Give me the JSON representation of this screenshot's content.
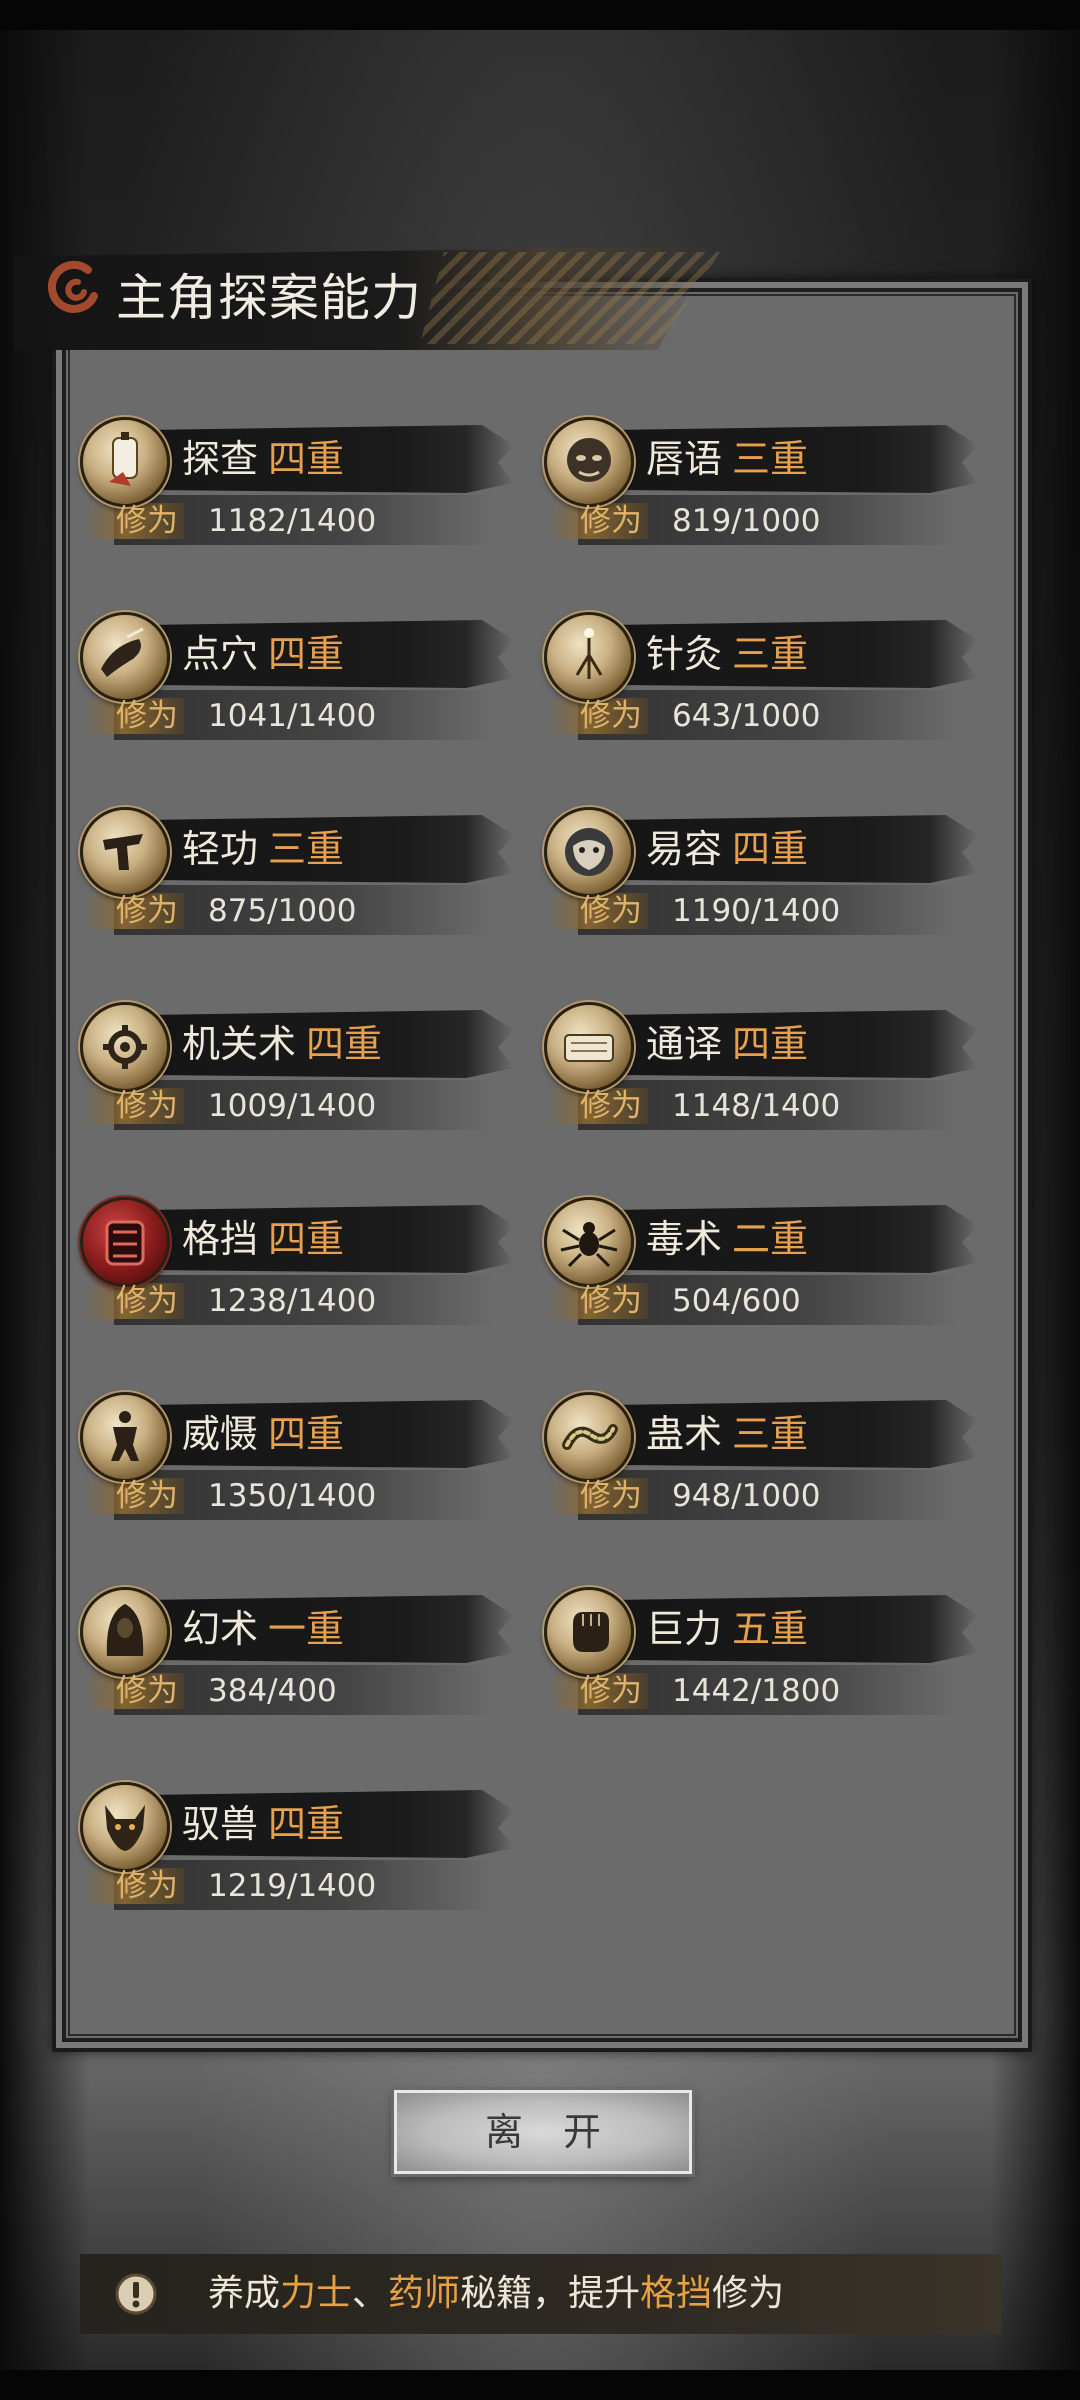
{
  "title": "主角探案能力",
  "xiuwei_label": "修为",
  "skills": [
    {
      "name": "探查",
      "level": "四重",
      "progress": "1182/1400",
      "value": 1182,
      "max": 1400,
      "icon": "lantern-icon"
    },
    {
      "name": "唇语",
      "level": "三重",
      "progress": "819/1000",
      "value": 819,
      "max": 1000,
      "icon": "mask-face-icon"
    },
    {
      "name": "点穴",
      "level": "四重",
      "progress": "1041/1400",
      "value": 1041,
      "max": 1400,
      "icon": "pressure-point-hand-icon"
    },
    {
      "name": "针灸",
      "level": "三重",
      "progress": "643/1000",
      "value": 643,
      "max": 1000,
      "icon": "acupuncture-needle-icon"
    },
    {
      "name": "轻功",
      "level": "三重",
      "progress": "875/1000",
      "value": 875,
      "max": 1000,
      "icon": "leaping-figure-icon"
    },
    {
      "name": "易容",
      "level": "四重",
      "progress": "1190/1400",
      "value": 1190,
      "max": 1400,
      "icon": "disguise-mask-icon"
    },
    {
      "name": "机关术",
      "level": "四重",
      "progress": "1009/1400",
      "value": 1009,
      "max": 1400,
      "icon": "gear-icon"
    },
    {
      "name": "通译",
      "level": "四重",
      "progress": "1148/1400",
      "value": 1148,
      "max": 1400,
      "icon": "scroll-icon"
    },
    {
      "name": "格挡",
      "level": "四重",
      "progress": "1238/1400",
      "value": 1238,
      "max": 1400,
      "icon": "shield-icon"
    },
    {
      "name": "毒术",
      "level": "二重",
      "progress": "504/600",
      "value": 504,
      "max": 600,
      "icon": "spider-icon"
    },
    {
      "name": "威慑",
      "level": "四重",
      "progress": "1350/1400",
      "value": 1350,
      "max": 1400,
      "icon": "warrior-stance-icon"
    },
    {
      "name": "蛊术",
      "level": "三重",
      "progress": "948/1000",
      "value": 948,
      "max": 1000,
      "icon": "worm-icon"
    },
    {
      "name": "幻术",
      "level": "一重",
      "progress": "384/400",
      "value": 384,
      "max": 400,
      "icon": "hooded-figure-icon"
    },
    {
      "name": "巨力",
      "level": "五重",
      "progress": "1442/1800",
      "value": 1442,
      "max": 1800,
      "icon": "fist-icon"
    },
    {
      "name": "驭兽",
      "level": "四重",
      "progress": "1219/1400",
      "value": 1219,
      "max": 1400,
      "icon": "wolf-head-icon"
    }
  ],
  "leave_button": "离开",
  "hint": {
    "icon": "exclamation-icon",
    "prefix": "养成",
    "book1": "力士",
    "sep": "、",
    "book2": "药师",
    "mid": "秘籍，提升",
    "skill": "格挡",
    "suffix": "修为"
  },
  "colors": {
    "level_accent": "#e7a04e",
    "xiuwei_label": "#e0b36a",
    "panel_bg": "#6b6b6b"
  }
}
